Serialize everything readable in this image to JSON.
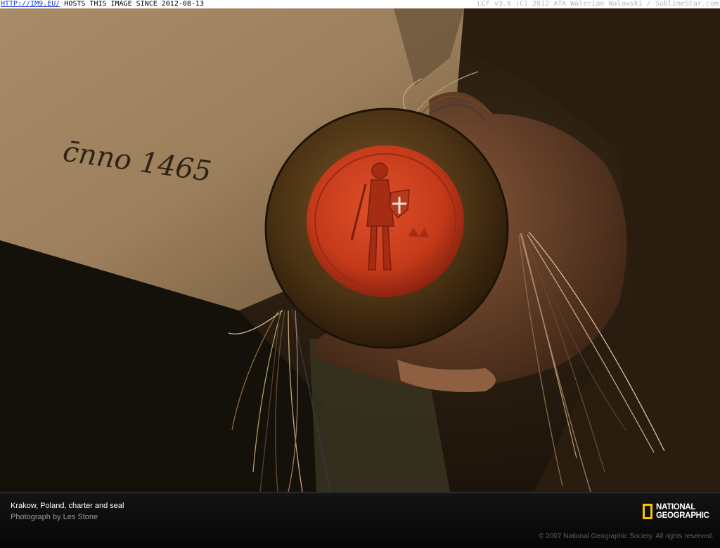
{
  "watermark": {
    "link": "HTTP://IM9.EU/",
    "hosts": "HOSTS THIS IMAGE SINCE 2012-08-13",
    "right": "LCF v3.6 (C) 2012 ATA Walerian Walawski / SublimeStar.com"
  },
  "photo": {
    "document_inscription": "c̄nno 1465"
  },
  "caption": {
    "title": "Krakow, Poland, charter and seal",
    "credit": "Photograph by Les Stone",
    "copyright": "© 2007 National Geographic Society. All rights reserved.",
    "logo_line1": "NATIONAL",
    "logo_line2": "GEOGRAPHIC",
    "logo_color": "#f6c400"
  }
}
